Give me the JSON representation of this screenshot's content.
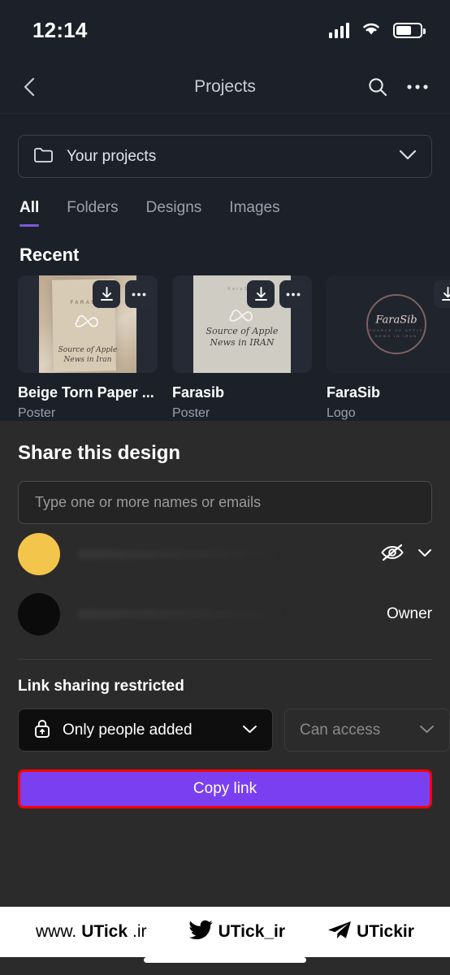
{
  "status_bar": {
    "time": "12:14",
    "signal_icon": "signal-bars-icon",
    "wifi_icon": "wifi-icon",
    "battery_icon": "battery-icon",
    "battery_level": 66
  },
  "navbar": {
    "back_icon": "chevron-left-icon",
    "title": "Projects",
    "search_icon": "search-icon",
    "more_icon": "more-horizontal-icon"
  },
  "picker": {
    "folder_icon": "folder-icon",
    "label": "Your projects",
    "chevron_icon": "chevron-down-icon"
  },
  "tabs": [
    {
      "label": "All",
      "active": true
    },
    {
      "label": "Folders",
      "active": false
    },
    {
      "label": "Designs",
      "active": false
    },
    {
      "label": "Images",
      "active": false
    }
  ],
  "recent": {
    "section_title": "Recent",
    "download_icon": "download-icon",
    "more_icon": "more-horizontal-icon",
    "cards": [
      {
        "title": "Beige Torn Paper ...",
        "subtitle": "Poster",
        "thumb_brand": "FARASIB",
        "thumb_text": "Source of Apple\nNews in Iran"
      },
      {
        "title": "Farasib",
        "subtitle": "Poster",
        "thumb_brand": "FaraSib",
        "thumb_text": "Source of Apple\nNews in IRAN"
      },
      {
        "title": "FaraSib",
        "subtitle": "Logo",
        "thumb_brand": "FaraSib",
        "thumb_text": "SOURCE OF APPLE\nNEWS IN IRAN"
      }
    ]
  },
  "share": {
    "title": "Share this design",
    "input_placeholder": "Type one or more names or emails",
    "people": [
      {
        "avatar_color": "#f3c54b",
        "name": "",
        "permission_icon": "eye-off-icon",
        "permission_chevron": "chevron-down-icon",
        "role": ""
      },
      {
        "avatar_color": "#0b0b0b",
        "name": "",
        "permission_icon": "",
        "permission_chevron": "",
        "role": "Owner"
      }
    ],
    "link_label": "Link sharing restricted",
    "access_select": {
      "lock_icon": "lock-icon",
      "label": "Only people added",
      "chevron_icon": "chevron-down-icon"
    },
    "permission_select": {
      "label": "Can access",
      "chevron_icon": "chevron-down-icon"
    },
    "copy_button": "Copy link"
  },
  "watermark": {
    "site": "www.UTick.ir",
    "site_prefix": "www.",
    "site_main": "UTick",
    "site_suffix": ".ir",
    "twitter_icon": "twitter-bird-icon",
    "twitter_handle": "UTick_ir",
    "telegram_icon": "telegram-plane-icon",
    "telegram_handle": "UTickir"
  },
  "colors": {
    "page_background": "#1c2029",
    "sheet_background": "#2b2b2b",
    "accent_purple": "#7b3ff2",
    "tab_underline": "#7c5cd6",
    "highlight_red": "#ff0000",
    "avatar_yellow": "#f3c54b"
  }
}
